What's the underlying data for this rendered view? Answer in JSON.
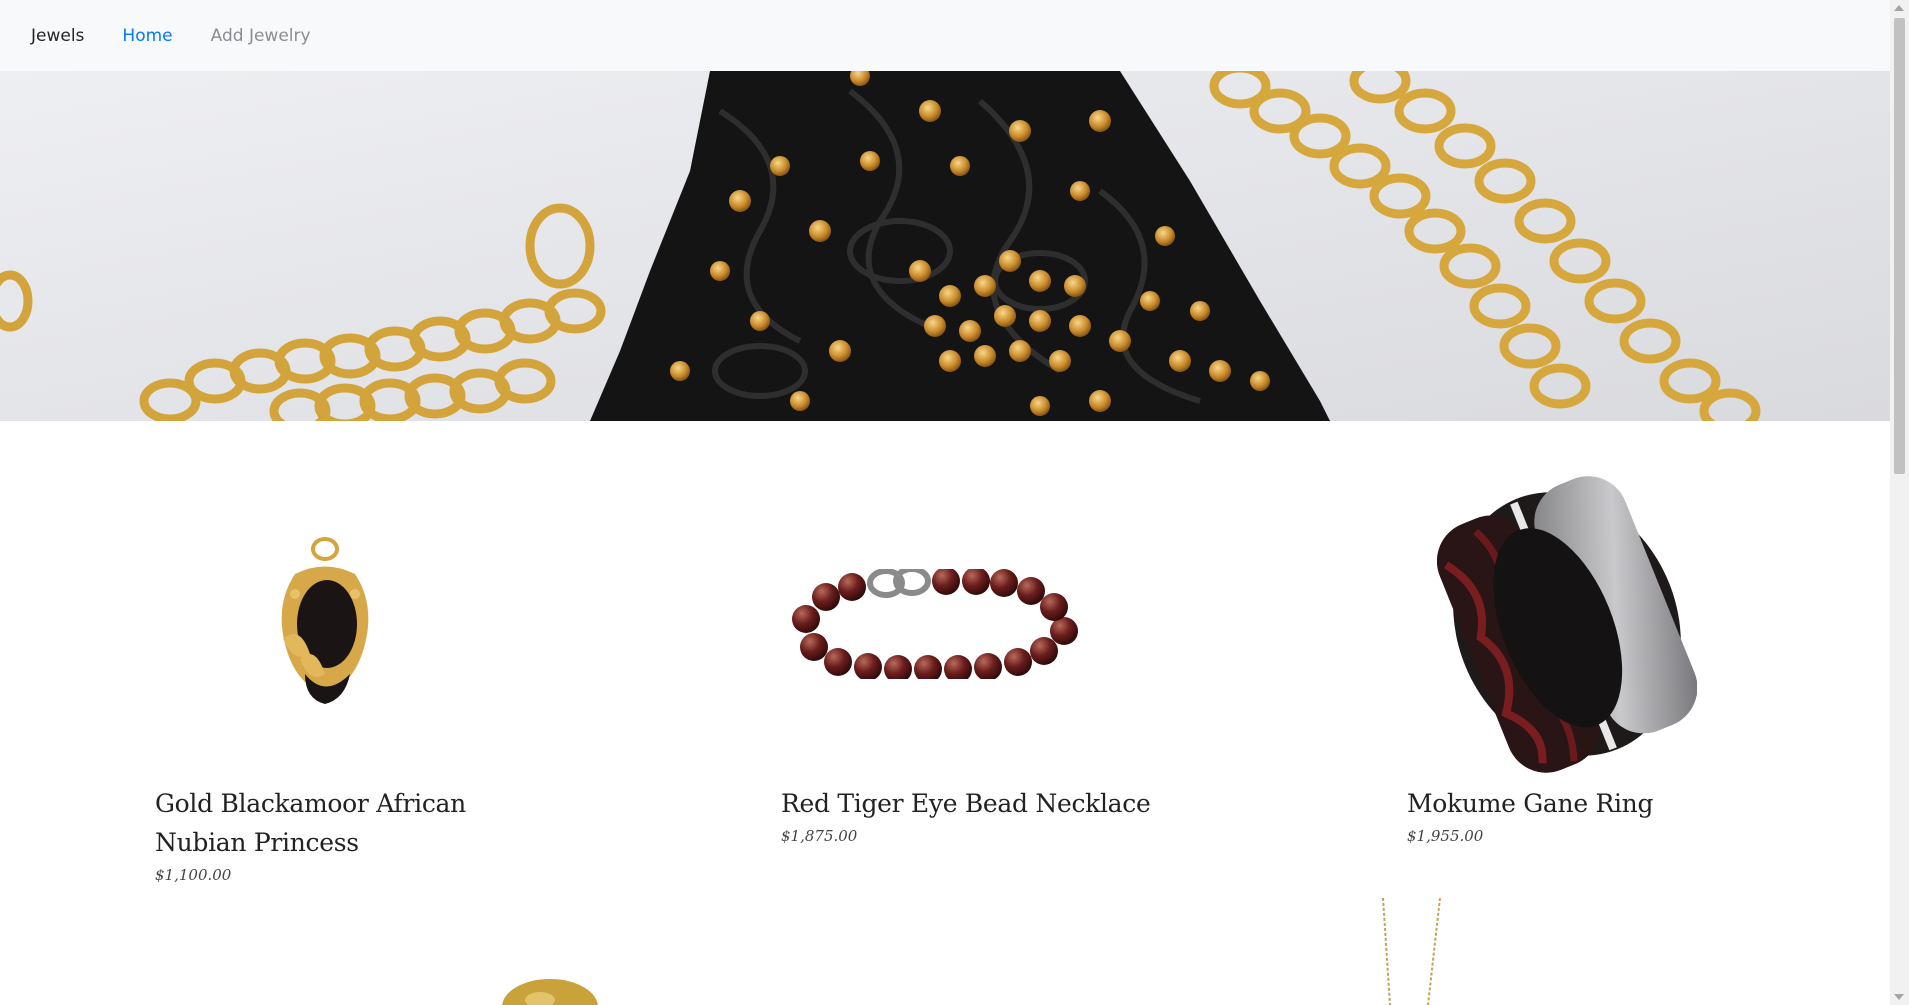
{
  "navbar": {
    "brand": "Jewels",
    "links": [
      {
        "label": "Home",
        "active": true
      },
      {
        "label": "Add Jewelry",
        "active": false
      }
    ]
  },
  "products": [
    {
      "title_line1": "Gold Blackamoor African",
      "title_line2": "Nubian Princess",
      "price": "$1,100.00",
      "icon": "pendant-image"
    },
    {
      "title_line1": "Red Tiger Eye Bead Necklace",
      "title_line2": "",
      "price": "$1,875.00",
      "icon": "bead-bracelet-image"
    },
    {
      "title_line1": "Mokume Gane Ring",
      "title_line2": "",
      "price": "$1,955.00",
      "icon": "ring-image"
    }
  ],
  "colors": {
    "nav_background": "#f8f9fa",
    "link_active": "#007bff",
    "link_muted": "#8a8e92",
    "gold": "#d9a93a"
  }
}
